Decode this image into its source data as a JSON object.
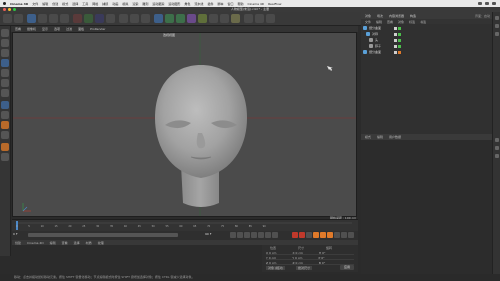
{
  "menubar": {
    "app": "Cinema 4D",
    "items": [
      "文件",
      "编辑",
      "创建",
      "模式",
      "选择",
      "工具",
      "网格",
      "捕捉",
      "动画",
      "模拟",
      "渲染",
      "雕刻",
      "运动跟踪",
      "运动图形",
      "角色",
      "流水线",
      "插件",
      "脚本",
      "窗口",
      "帮助"
    ],
    "extras": [
      "Cinema 4D",
      "RealFlow",
      "Octane"
    ]
  },
  "window": {
    "title": "人物模型(未渲).c4d * - 主要"
  },
  "viewport": {
    "menu": [
      "查看",
      "摄像机",
      "显示",
      "选项",
      "过滤",
      "面板",
      "ProRender"
    ],
    "label": "透视视图",
    "grid_distance": "网格间距 : 100 cm"
  },
  "timeline": {
    "ticks": [
      "0",
      "5",
      "10",
      "15",
      "20",
      "25",
      "30",
      "35",
      "40",
      "45",
      "50",
      "55",
      "60",
      "65",
      "70",
      "75",
      "80",
      "85",
      "90"
    ],
    "current_frame": "0 F",
    "end_frame": "90 F",
    "frame_field": "90 F"
  },
  "bottom": {
    "menu": [
      "创建",
      "Cinema 4D",
      "编辑",
      "查看",
      "选择",
      "材质",
      "纹理"
    ],
    "coord_headers": [
      "位置",
      "尺寸",
      "旋转"
    ],
    "coord_rows": [
      {
        "a": "X 0 cm",
        "b": "X 0 cm",
        "c": "H 0°"
      },
      {
        "a": "Y 0 cm",
        "b": "Y 0 cm",
        "c": "P 0°"
      },
      {
        "a": "Z 0 cm",
        "b": "Z 0 cm",
        "c": "B 0°"
      }
    ],
    "mode_left": "对象 (相对)",
    "mode_right": "绝对尺寸",
    "apply": "应用"
  },
  "status": "移动：点击并拖动鼠标移动元素。按住 SHIFT 键量化移动；节点编辑模式时按住 SHIFT 键增加选择对象；按住 CTRL 键减少选择对象。",
  "right_panel": {
    "tabs": [
      "对象",
      "场次",
      "内容浏览器",
      "构造"
    ],
    "menu": [
      "文件",
      "编辑",
      "查看",
      "对象",
      "标签",
      "书签"
    ],
    "layout": "界面：启动",
    "objects": [
      {
        "name": "细分曲面",
        "color": "#5aa0d8"
      },
      {
        "name": "对称",
        "color": "#5aa0d8"
      },
      {
        "name": "头",
        "color": "#9a9a9a"
      },
      {
        "name": "脖子",
        "color": "#9a9a9a"
      },
      {
        "name": "细分曲面",
        "color": "#5aa0d8"
      }
    ],
    "attr_tabs": [
      "模式",
      "编辑",
      "用户数据"
    ]
  },
  "colors": {
    "accent": "#e07a2a",
    "axis_red": "#c0392b",
    "axis_green": "#2e9e4a",
    "selection": "#4c89c8"
  }
}
